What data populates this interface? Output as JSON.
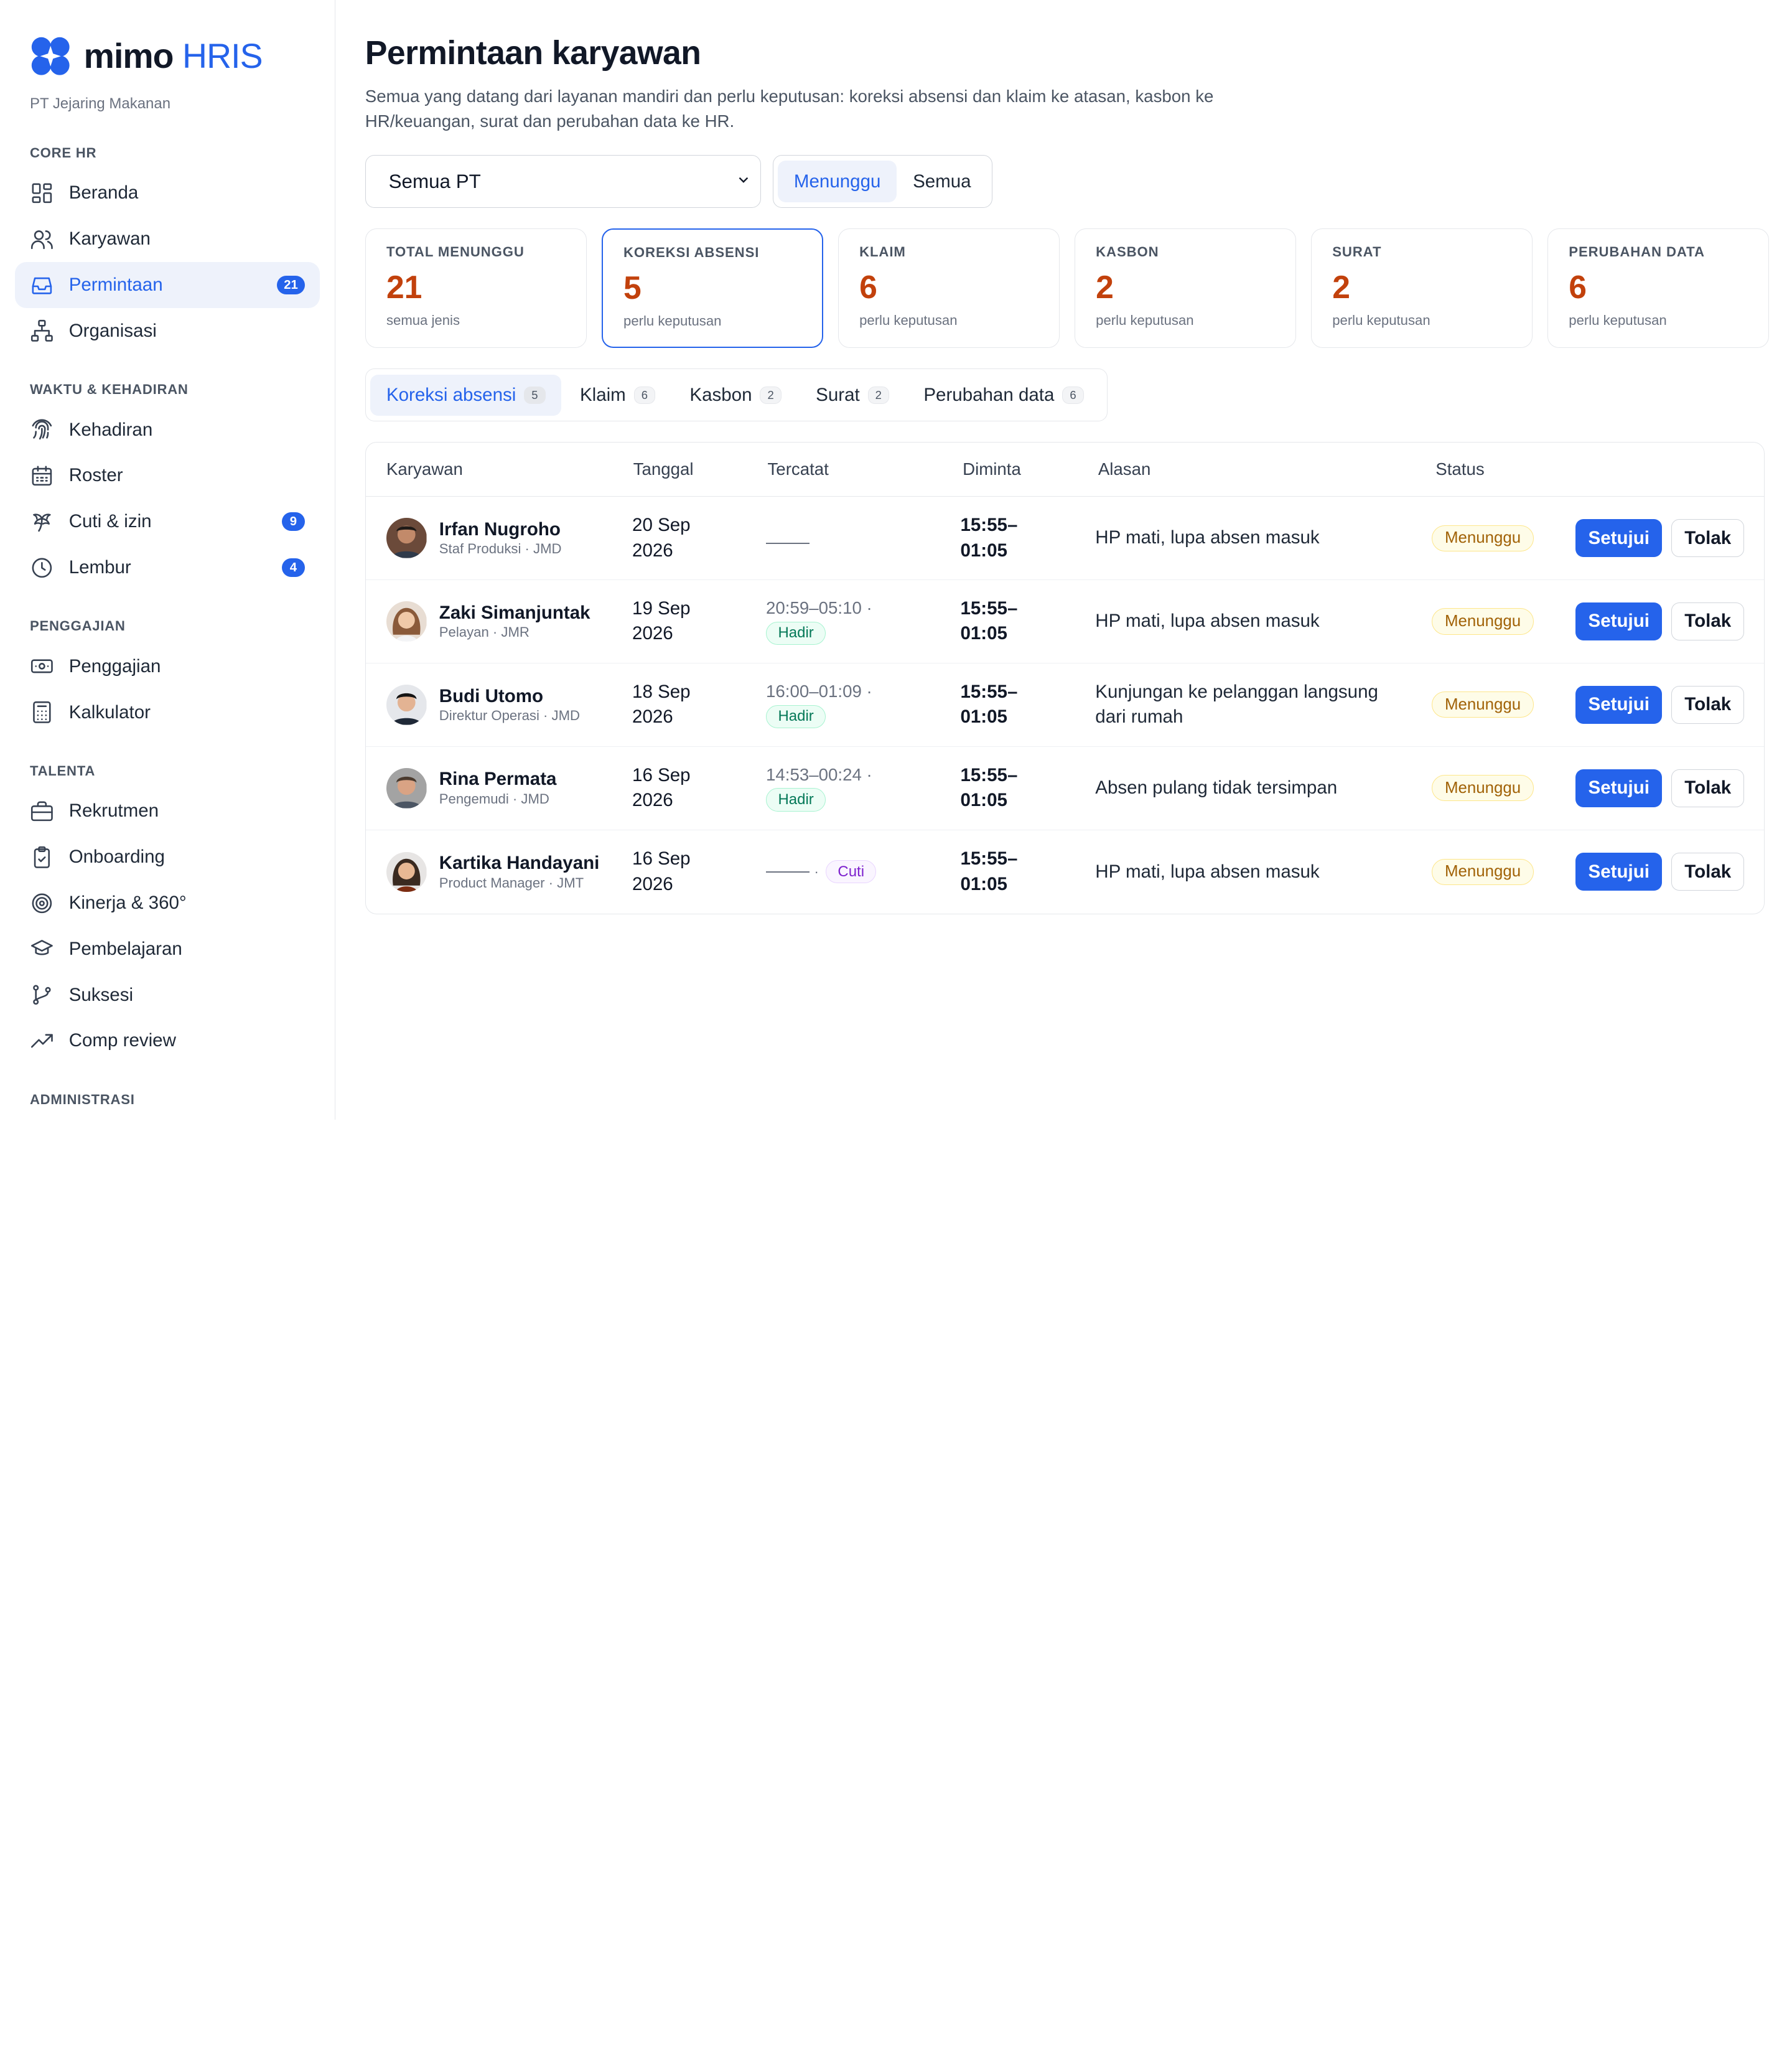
{
  "brand": {
    "name": "mimo",
    "suffix": "HRIS",
    "company": "PT Jejaring Makanan"
  },
  "sidebar": {
    "sections": [
      {
        "title": "CORE HR",
        "items": [
          {
            "label": "Beranda",
            "icon": "dashboard-icon"
          },
          {
            "label": "Karyawan",
            "icon": "users-icon"
          },
          {
            "label": "Permintaan",
            "icon": "inbox-icon",
            "badge": "21",
            "active": true
          },
          {
            "label": "Organisasi",
            "icon": "org-chart-icon"
          }
        ]
      },
      {
        "title": "WAKTU & KEHADIRAN",
        "items": [
          {
            "label": "Kehadiran",
            "icon": "fingerprint-icon"
          },
          {
            "label": "Roster",
            "icon": "calendar-icon"
          },
          {
            "label": "Cuti & izin",
            "icon": "palm-tree-icon",
            "badge": "9"
          },
          {
            "label": "Lembur",
            "icon": "clock-icon",
            "badge": "4"
          }
        ]
      },
      {
        "title": "PENGGAJIAN",
        "items": [
          {
            "label": "Penggajian",
            "icon": "banknote-icon"
          },
          {
            "label": "Kalkulator",
            "icon": "calculator-icon"
          }
        ]
      },
      {
        "title": "TALENTA",
        "items": [
          {
            "label": "Rekrutmen",
            "icon": "briefcase-icon"
          },
          {
            "label": "Onboarding",
            "icon": "clipboard-check-icon"
          },
          {
            "label": "Kinerja & 360°",
            "icon": "target-icon"
          },
          {
            "label": "Pembelajaran",
            "icon": "graduation-cap-icon"
          },
          {
            "label": "Suksesi",
            "icon": "git-branch-icon"
          },
          {
            "label": "Comp review",
            "icon": "trending-up-icon"
          }
        ]
      },
      {
        "title": "ADMINISTRASI",
        "items": []
      }
    ]
  },
  "page": {
    "title": "Permintaan karyawan",
    "description": "Semua yang datang dari layanan mandiri dan perlu keputusan: koreksi absensi dan klaim ke atasan, kasbon ke HR/keuangan, surat dan perubahan data ke HR."
  },
  "filters": {
    "company_select": "Semua PT",
    "status_toggle": [
      {
        "label": "Menunggu",
        "active": true
      },
      {
        "label": "Semua",
        "active": false
      }
    ]
  },
  "summary_cards": [
    {
      "title": "TOTAL MENUNGGU",
      "value": "21",
      "sub": "semua jenis"
    },
    {
      "title": "KOREKSI ABSENSI",
      "value": "5",
      "sub": "perlu keputusan",
      "selected": true
    },
    {
      "title": "KLAIM",
      "value": "6",
      "sub": "perlu keputusan"
    },
    {
      "title": "KASBON",
      "value": "2",
      "sub": "perlu keputusan"
    },
    {
      "title": "SURAT",
      "value": "2",
      "sub": "perlu keputusan"
    },
    {
      "title": "PERUBAHAN DATA",
      "value": "6",
      "sub": "perlu keputusan"
    }
  ],
  "tabs": [
    {
      "label": "Koreksi absensi",
      "count": "5",
      "active": true
    },
    {
      "label": "Klaim",
      "count": "6"
    },
    {
      "label": "Kasbon",
      "count": "2"
    },
    {
      "label": "Surat",
      "count": "2"
    },
    {
      "label": "Perubahan data",
      "count": "6"
    }
  ],
  "table": {
    "headers": [
      "Karyawan",
      "Tanggal",
      "Tercatat",
      "Diminta",
      "Alasan",
      "Status"
    ],
    "approve_label": "Setujui",
    "reject_label": "Tolak",
    "rows": [
      {
        "name": "Irfan Nugroho",
        "meta": "Staf Produksi · JMD",
        "date_1": "20 Sep",
        "date_2": "2026",
        "recorded": "",
        "recorded_sep": "",
        "record_badge": "",
        "requested_1": "15:55–",
        "requested_2": "01:05",
        "reason": "HP mati, lupa absen masuk",
        "status": "Menunggu"
      },
      {
        "name": "Zaki Simanjuntak",
        "meta": "Pelayan · JMR",
        "date_1": "19 Sep",
        "date_2": "2026",
        "recorded": "20:59–05:10",
        "recorded_sep": "·",
        "record_badge": "Hadir",
        "requested_1": "15:55–",
        "requested_2": "01:05",
        "reason": "HP mati, lupa absen masuk",
        "status": "Menunggu"
      },
      {
        "name": "Budi Utomo",
        "meta": "Direktur Operasi · JMD",
        "date_1": "18 Sep",
        "date_2": "2026",
        "recorded": "16:00–01:09",
        "recorded_sep": "·",
        "record_badge": "Hadir",
        "requested_1": "15:55–",
        "requested_2": "01:05",
        "reason": "Kunjungan ke pelanggan langsung dari rumah",
        "status": "Menunggu"
      },
      {
        "name": "Rina Permata",
        "meta": "Pengemudi · JMD",
        "date_1": "16 Sep",
        "date_2": "2026",
        "recorded": "14:53–00:24",
        "recorded_sep": "·",
        "record_badge": "Hadir",
        "requested_1": "15:55–",
        "requested_2": "01:05",
        "reason": "Absen pulang tidak tersimpan",
        "status": "Menunggu"
      },
      {
        "name": "Kartika Handayani",
        "meta": "Product Manager · JMT",
        "date_1": "16 Sep",
        "date_2": "2026",
        "recorded": "",
        "recorded_sep": "·",
        "record_badge": "Cuti",
        "requested_1": "15:55–",
        "requested_2": "01:05",
        "reason": "HP mati, lupa absen masuk",
        "status": "Menunggu"
      }
    ]
  },
  "colors": {
    "accent": "#2563eb",
    "value_orange": "#c2410c",
    "status_yellow": "#a16207"
  }
}
